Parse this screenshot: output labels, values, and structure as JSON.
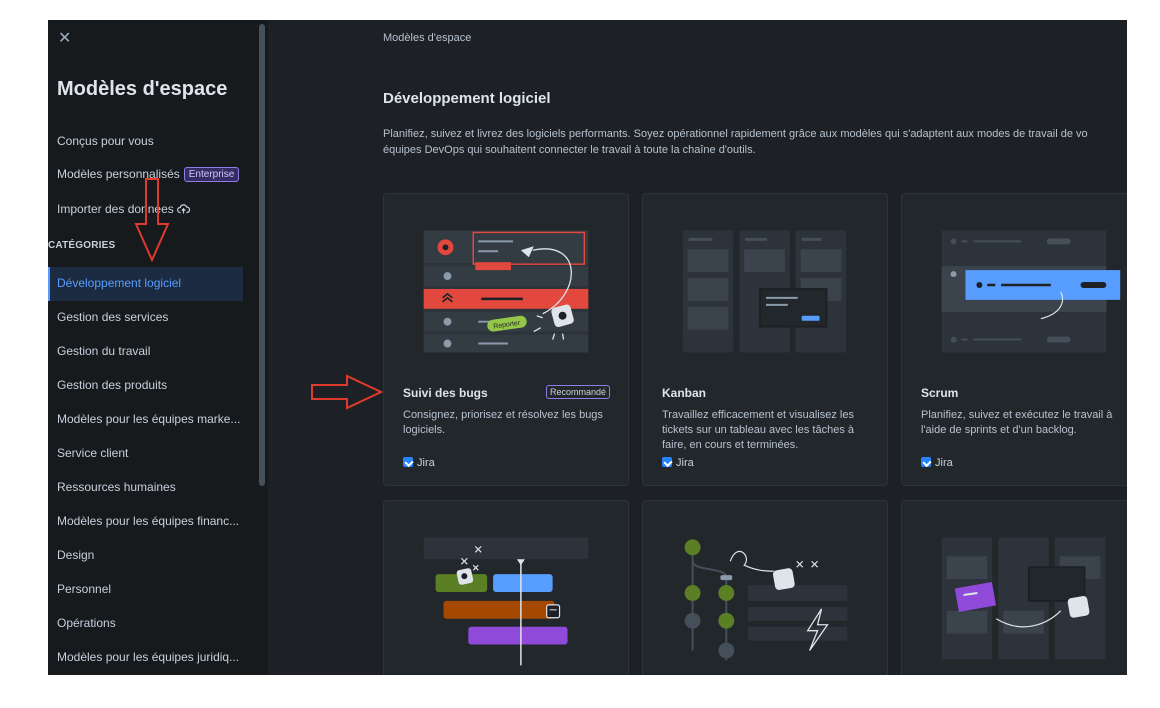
{
  "sidebar": {
    "close": "✕",
    "title": "Modèles d'espace",
    "links": {
      "for_you": "Conçus pour vous",
      "custom": "Modèles personnalisés",
      "custom_badge": "Enterprise",
      "import": "Importer des données"
    },
    "categories_label": "CATÉGORIES",
    "categories": [
      "Développement logiciel",
      "Gestion des services",
      "Gestion du travail",
      "Gestion des produits",
      "Modèles pour les équipes marke...",
      "Service client",
      "Ressources humaines",
      "Modèles pour les équipes financ...",
      "Design",
      "Personnel",
      "Opérations",
      "Modèles pour les équipes juridiq..."
    ],
    "active_index": 0
  },
  "main": {
    "breadcrumb": "Modèles d'espace",
    "title": "Développement logiciel",
    "description_line1": "Planifiez, suivez et livrez des logiciels performants. Soyez opérationnel rapidement grâce aux modèles qui s'adaptent aux modes de travail de vo",
    "description_line2": "équipes DevOps qui souhaitent connecter le travail à toute la chaîne d'outils.",
    "cards": [
      {
        "title": "Suivi des bugs",
        "badge": "Recommandé",
        "description": "Consignez, priorisez et résolvez les bugs logiciels.",
        "product": "Jira",
        "illustration_text": "Reporter"
      },
      {
        "title": "Kanban",
        "description": "Travaillez efficacement et visualisez les tickets sur un tableau avec les tâches à faire, en cours et terminées.",
        "product": "Jira"
      },
      {
        "title": "Scrum",
        "description": "Planifiez, suivez et exécutez le travail à l'aide de sprints et d'un backlog.",
        "product": "Jira"
      }
    ]
  },
  "colors": {
    "background": "#1d2125",
    "sidebar": "#161a1d",
    "card": "#22272b",
    "accent_blue": "#579dff",
    "bug_red": "#e2483d",
    "purple_badge": "#8f7ee7",
    "annotation_red": "#e03a2f"
  },
  "icons": [
    "close-icon",
    "cloud-upload-icon",
    "jira-icon",
    "bug-icon",
    "chevron-up-icon",
    "lightbulb-icon",
    "code-icon",
    "lightning-icon",
    "rocket-icon"
  ]
}
